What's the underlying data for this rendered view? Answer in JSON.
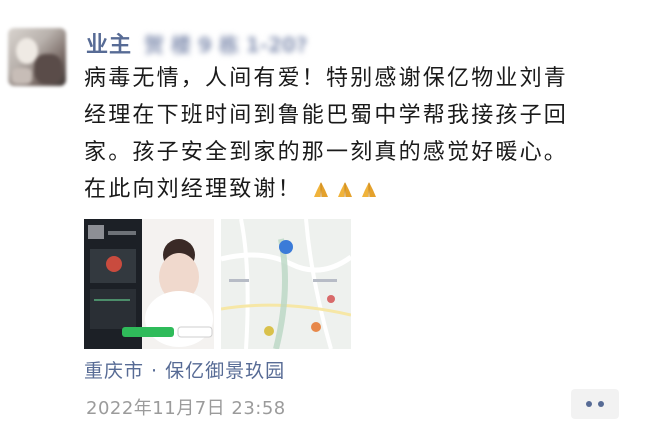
{
  "post": {
    "nickname": "业主",
    "nickname_suffix_blurred": "贺 楼 9 栋 1-20?",
    "text_line1": "病毒无情，人间有爱！特别感谢保亿物业刘青",
    "text_line2": "经理在下班时间到鲁能巴蜀中学帮我接孩子回",
    "text_line3": "家。孩子安全到家的那一刻真的感觉好暖心。",
    "text_line4": "在此向刘经理致谢！",
    "emoji_icons": [
      "pray-icon",
      "pray-icon",
      "pray-icon"
    ],
    "location": "重庆市 · 保亿御景玖园",
    "timestamp": "2022年11月7日 23:58"
  },
  "images": [
    {
      "kind": "screenshot",
      "icon": "photo-video-call"
    },
    {
      "kind": "map",
      "icon": "map-icon"
    }
  ],
  "colors": {
    "link_blue": "#576b95",
    "text": "#1a1a1a",
    "time_gray": "#9b9b9b",
    "button_bg": "#f2f2f2"
  }
}
